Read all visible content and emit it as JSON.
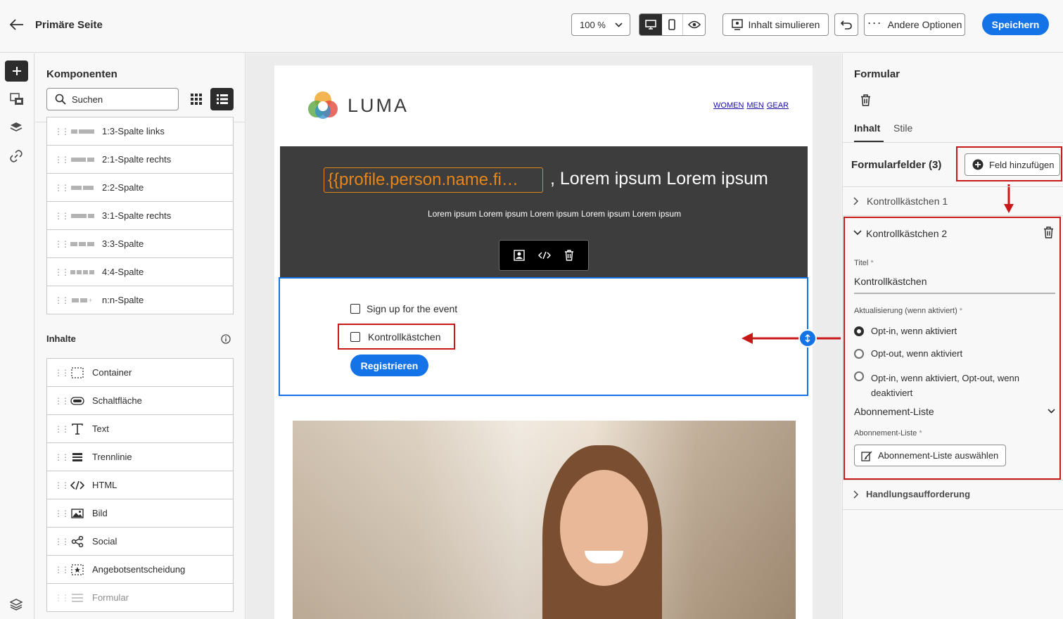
{
  "header": {
    "title": "Primäre Seite",
    "zoom": "100 %",
    "simulate_label": "Inhalt simulieren",
    "more_label": "Andere Optionen",
    "save_label": "Speichern"
  },
  "components": {
    "title": "Komponenten",
    "search_placeholder": "Suchen",
    "structures": [
      "1:3-Spalte links",
      "2:1-Spalte rechts",
      "2:2-Spalte",
      "3:1-Spalte rechts",
      "3:3-Spalte",
      "4:4-Spalte",
      "n:n-Spalte"
    ],
    "content_title": "Inhalte",
    "contents": [
      "Container",
      "Schaltfläche",
      "Text",
      "Trennlinie",
      "HTML",
      "Bild",
      "Social",
      "Angebotsentscheidung",
      "Formular"
    ]
  },
  "email": {
    "logo_text": "LUMA",
    "nav": [
      "WOMEN",
      "MEN",
      "GEAR"
    ],
    "hero_token": "{{profile.person.name.fi…",
    "hero_title": ", Lorem ipsum Lorem ipsum",
    "hero_sub": "Lorem ipsum Lorem ipsum Lorem ipsum Lorem ipsum Lorem ipsum",
    "checkbox1": "Sign up for the event",
    "checkbox2": "Kontrollkästchen",
    "register_label": "Registrieren"
  },
  "props": {
    "title": "Formular",
    "tabs": [
      "Inhalt",
      "Stile"
    ],
    "fields_title": "Formularfelder (3)",
    "add_field_label": "Feld hinzufügen",
    "field1": "Kontrollkästchen 1",
    "field2": "Kontrollkästchen 2",
    "title_label": "Titel",
    "title_value": "Kontrollkästchen",
    "update_label": "Aktualisierung (wenn aktiviert)",
    "options": [
      "Opt-in, wenn aktiviert",
      "Opt-out, wenn aktiviert",
      "Opt-in, wenn aktiviert, Opt-out, wenn deaktiviert"
    ],
    "sub_list_section": "Abonnement-Liste",
    "sub_list_label": "Abonnement-Liste",
    "sub_list_button": "Abonnement-Liste auswählen",
    "cta_label": "Handlungsaufforderung",
    "required_mark": "*"
  },
  "colors": {
    "accent": "#1473e6",
    "annotation": "#c91818",
    "token": "#e68619",
    "hero_bg": "#3d3d3d"
  }
}
